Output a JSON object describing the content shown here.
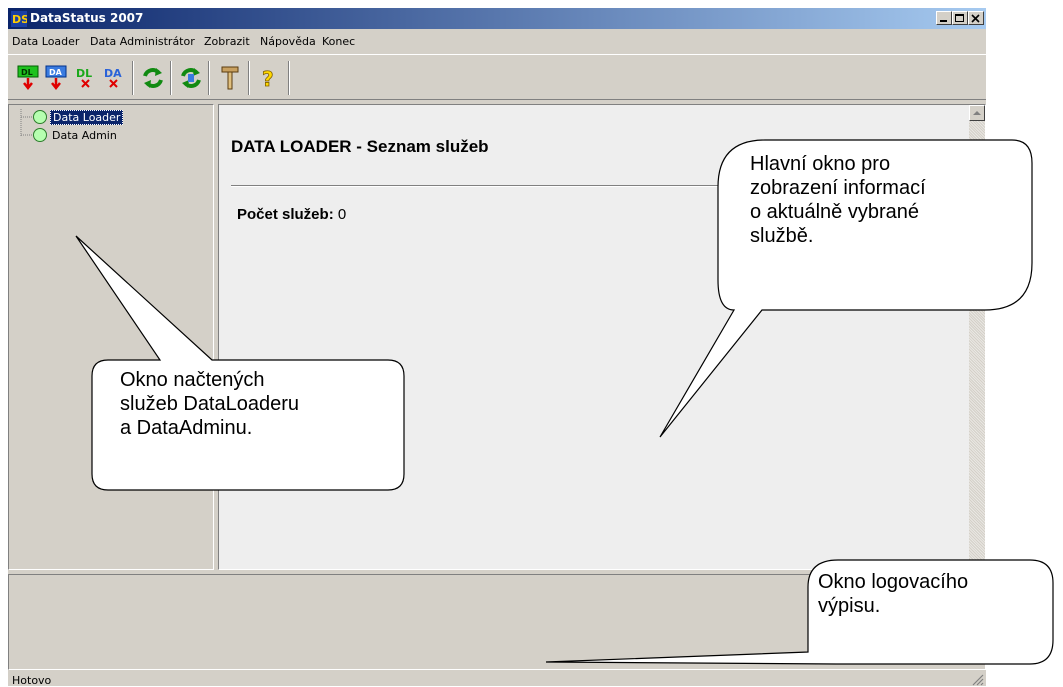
{
  "window": {
    "title": "DataStatus 2007",
    "controls": [
      "minimize-icon",
      "maximize-icon",
      "close-icon"
    ]
  },
  "menu": {
    "items": [
      "Data Loader",
      "Data Administrátor",
      "Zobrazit",
      "Nápověda",
      "Konec"
    ]
  },
  "toolbar": {
    "buttons": [
      {
        "name": "dl-start-icon",
        "label": "DL"
      },
      {
        "name": "da-start-icon",
        "label": "DA"
      },
      {
        "name": "dl-stop-icon",
        "label": "DL"
      },
      {
        "name": "da-stop-icon",
        "label": "DA"
      },
      {
        "name": "refresh-icon"
      },
      {
        "name": "refresh-all-icon"
      },
      {
        "name": "tools-icon"
      },
      {
        "name": "help-icon",
        "label": "?"
      }
    ]
  },
  "tree": {
    "items": [
      {
        "label": "Data Loader",
        "selected": true
      },
      {
        "label": "Data Admin",
        "selected": false
      }
    ]
  },
  "main": {
    "title": "DATA LOADER - Seznam služeb",
    "count_label": "Počet služeb:",
    "count_value": "0"
  },
  "status": {
    "text": "Hotovo"
  },
  "callouts": {
    "left": [
      "Okno načtených",
      "služeb DataLoaderu",
      "a DataAdminu."
    ],
    "right": [
      "Hlavní okno pro",
      "zobrazení informací",
      "o aktuálně vybrané",
      "službě."
    ],
    "bottom": [
      "Okno logovacího",
      "výpisu."
    ]
  },
  "colors": {
    "title_start": "#0a246a",
    "title_end": "#a6caf0",
    "window_bg": "#d4d0c8",
    "main_bg": "#eeeeee"
  }
}
